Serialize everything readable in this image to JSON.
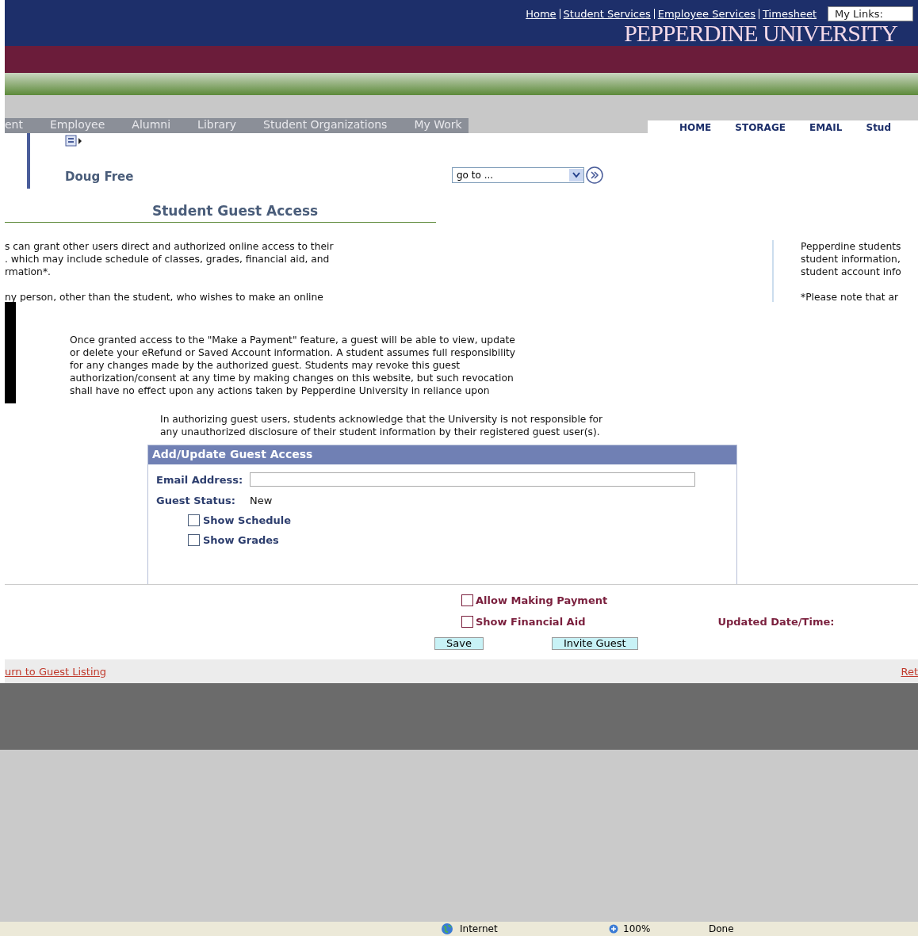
{
  "top_links": [
    "Home",
    "Student Services",
    "Employee Services",
    "Timesheet"
  ],
  "my_links": "My Links:",
  "logo": "PEPPERDINE UNIVERSITY",
  "nav_tabs": [
    "ent",
    "Employee",
    "Alumni",
    "Library",
    "Student Organizations",
    "My Work"
  ],
  "right_tabs": [
    "HOME",
    "STORAGE",
    "EMAIL",
    "Stud"
  ],
  "user_name": "Doug Free",
  "goto": {
    "value": "go to ..."
  },
  "page_title": "Student Guest Access",
  "intro_left": [
    [
      "s can grant other users direct and authorized online access to their",
      ". which may include schedule of classes, grades, financial aid, and",
      "rmation*."
    ],
    [
      "ny person, other than the student, who wishes to make an online"
    ]
  ],
  "intro_right": [
    [
      "Pepperdine students",
      "student information,",
      "student account info"
    ],
    [
      "*Please note that ar"
    ]
  ],
  "notice": [
    "Once granted access to the \"Make a Payment\" feature, a guest will be able to view, update",
    "or delete your eRefund or Saved Account information. A student assumes full responsibility",
    "for any changes made by the authorized guest. Students may revoke this guest",
    "authorization/consent at any time by making changes on this website, but such revocation",
    "shall have no effect upon any actions taken by Pepperdine University in reliance upon"
  ],
  "disclaimer": [
    "In authorizing guest users, students acknowledge that the University is not responsible for",
    "any unauthorized disclosure of their student information by their registered guest user(s)."
  ],
  "form": {
    "title": "Add/Update Guest Access",
    "email_label": "Email Address:",
    "status_label": "Guest Status:",
    "status_value": "New",
    "options": [
      {
        "label": "Show Schedule",
        "checked": false
      },
      {
        "label": "Show Grades",
        "checked": false
      }
    ]
  },
  "lower_options": [
    {
      "label": "Allow Making Payment",
      "checked": false
    },
    {
      "label": "Show Financial Aid",
      "checked": false
    }
  ],
  "updated_label": "Updated Date/Time:",
  "buttons": [
    "Save",
    "Invite Guest"
  ],
  "return_links": [
    "urn to Guest Listing",
    "Ret"
  ],
  "status_bar": {
    "zone": "Internet",
    "zoom": "100%",
    "status": "Done"
  }
}
